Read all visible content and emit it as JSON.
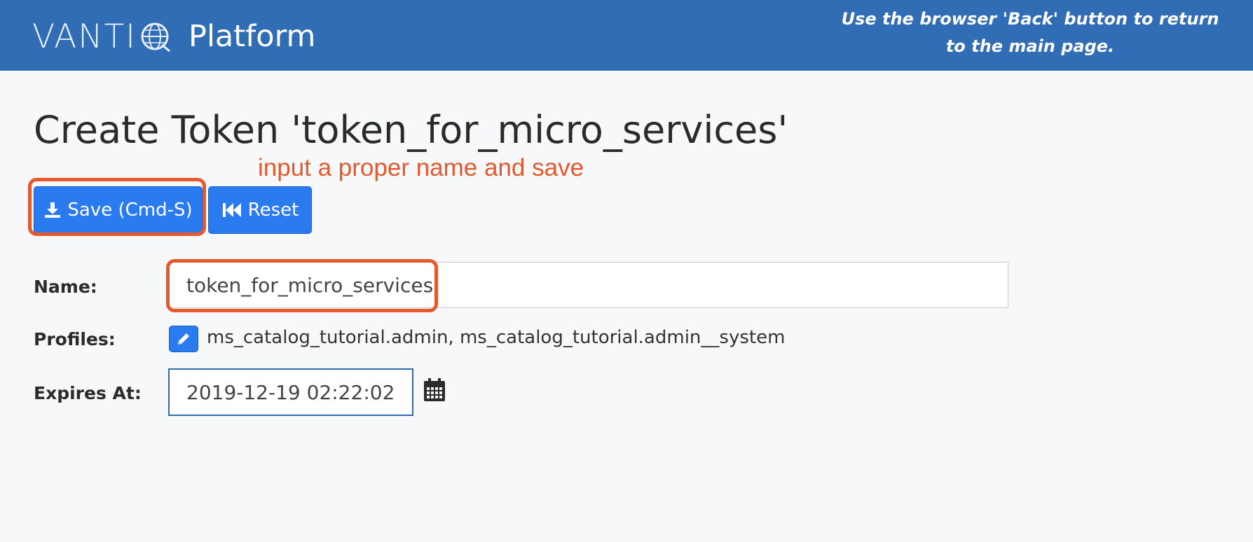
{
  "header": {
    "logo_text": "VANTIQ",
    "logo_visible_text": "VANTI",
    "product": "Platform",
    "note": "Use the browser 'Back' button to return to the main page."
  },
  "page": {
    "title": "Create Token 'token_for_micro_services'"
  },
  "annotation": {
    "text": "input a proper name and save",
    "color": "#e05a2e"
  },
  "toolbar": {
    "save_label": "Save (Cmd-S)",
    "reset_label": "Reset"
  },
  "form": {
    "name_label": "Name:",
    "name_value": "token_for_micro_services",
    "profiles_label": "Profiles:",
    "profiles_value": "ms_catalog_tutorial.admin, ms_catalog_tutorial.admin__system",
    "expires_label": "Expires At:",
    "expires_value": "2019-12-19 02:22:02"
  },
  "icons": {
    "save": "download-icon",
    "reset": "fast-backward-icon",
    "edit_profiles": "pencil-icon",
    "calendar": "calendar-icon"
  },
  "colors": {
    "header_bg": "#316db4",
    "primary_button": "#2b7bf0",
    "highlight": "#e8582e"
  }
}
